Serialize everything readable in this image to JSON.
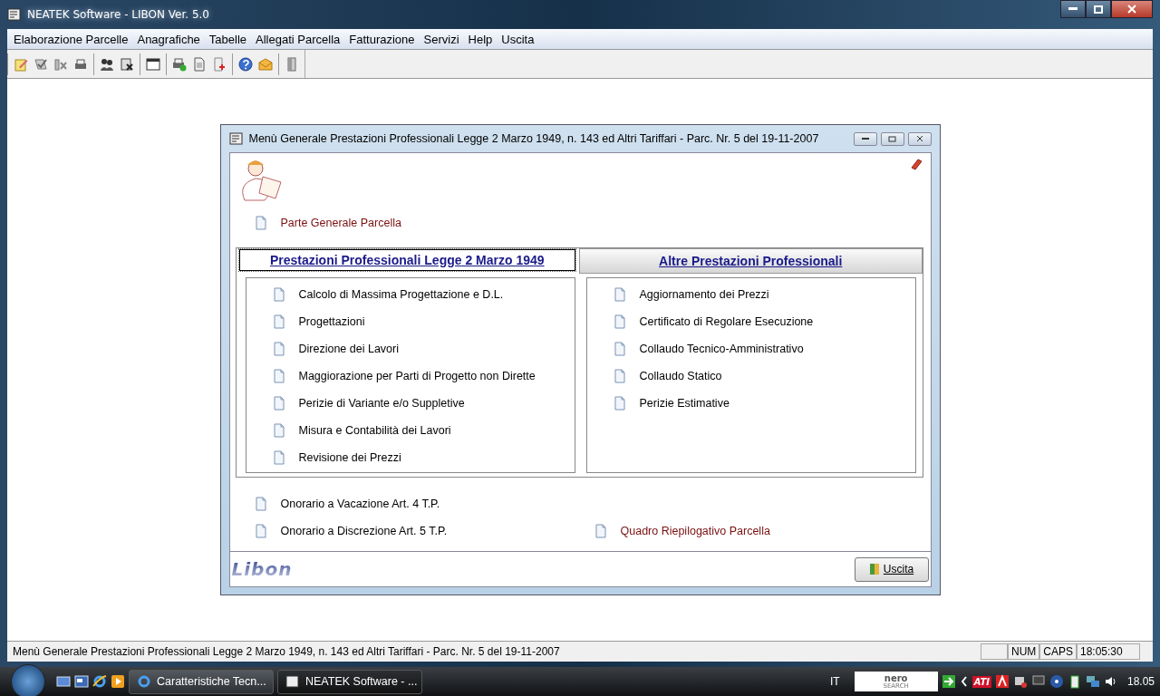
{
  "window": {
    "title": "NEATEK Software  -  LIBON Ver. 5.0"
  },
  "menu": [
    "Elaborazione Parcelle",
    "Anagrafiche",
    "Tabelle",
    "Allegati Parcella",
    "Fatturazione",
    "Servizi",
    "Help",
    "Uscita"
  ],
  "toolbar_groups": [
    [
      {
        "kind": "edit"
      },
      {
        "kind": "check"
      },
      {
        "kind": "chart"
      },
      {
        "kind": "printer"
      }
    ],
    [
      {
        "kind": "people"
      },
      {
        "kind": "docx"
      }
    ],
    [
      {
        "kind": "window"
      }
    ],
    [
      {
        "kind": "printok"
      },
      {
        "kind": "page"
      },
      {
        "kind": "pageplus"
      }
    ],
    [
      {
        "kind": "help"
      },
      {
        "kind": "mail"
      }
    ],
    [
      {
        "kind": "door"
      }
    ]
  ],
  "dialog": {
    "title": "Menù Generale Prestazioni Professionali Legge 2 Marzo 1949, n. 143 ed Altri Tariffari - Parc. Nr. 5  del 19-11-2007",
    "general_item": "Parte Generale Parcella",
    "tabs": [
      {
        "label": "Prestazioni Professionali Legge 2 Marzo 1949",
        "selected": true
      },
      {
        "label": "Altre Prestazioni Professionali",
        "selected": false
      }
    ],
    "left_items": [
      "Calcolo di Massima Progettazione e D.L.",
      "Progettazioni",
      "Direzione dei Lavori",
      "Maggiorazione per Parti di Progetto non Dirette",
      "Perizie di Variante e/o Suppletive",
      "Misura e Contabilità dei Lavori",
      "Revisione dei Prezzi"
    ],
    "right_items": [
      "Aggiornamento dei Prezzi",
      "Certificato di Regolare Esecuzione",
      "Collaudo Tecnico-Amministrativo",
      "Collaudo Statico",
      "Perizie Estimative"
    ],
    "bottom_items": [
      "Onorario a Vacazione Art. 4 T.P.",
      "Onorario a Discrezione Art. 5 T.P."
    ],
    "summary_item": "Quadro Riepilogativo Parcella",
    "logo": "Libon",
    "exit_button": "Uscita"
  },
  "status_bar": {
    "message": "Menù Generale Prestazioni Professionali Legge 2 Marzo 1949, n. 143 ed Altri Tariffari - Parc. Nr. 5  del 19-11-2007",
    "indicators": [
      "NUM",
      "CAPS",
      "18:05:30"
    ]
  },
  "taskbar": {
    "tasks": [
      {
        "label": "Caratteristiche Tecn...",
        "kind": "browser",
        "selected": false
      },
      {
        "label": "NEATEK Software  - ...",
        "kind": "app",
        "selected": true
      }
    ],
    "language": "IT",
    "search_logo": "nero",
    "search_sub": "SEARCH",
    "tray_label": "ATI",
    "clock": "18.05"
  }
}
